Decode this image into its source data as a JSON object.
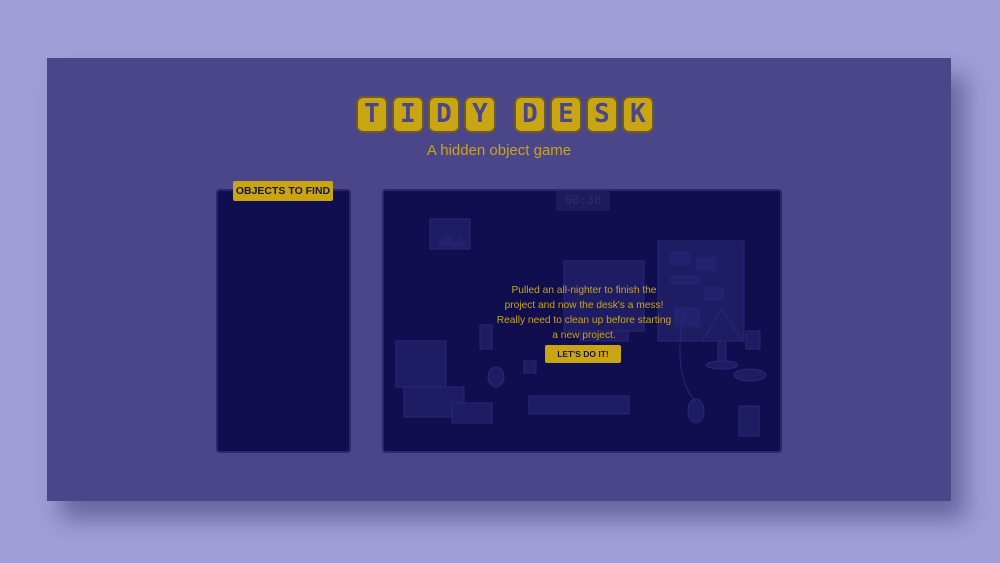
{
  "game": {
    "title_letters": [
      "T",
      "I",
      "D",
      "Y",
      "",
      "D",
      "E",
      "S",
      "K"
    ],
    "subtitle": "A hidden object game"
  },
  "sidebar": {
    "header_label": "OBJECTS TO FIND"
  },
  "scene": {
    "timer": "00:30",
    "intro_text": "Pulled an all-nighter to finish the project and now the desk's a mess! Really need to clean up before starting a new project.",
    "start_button_label": "LET'S DO IT!"
  },
  "colors": {
    "background": "#a09dd8",
    "window": "#4a4689",
    "panel": "#100e4e",
    "accent": "#c9a514"
  }
}
